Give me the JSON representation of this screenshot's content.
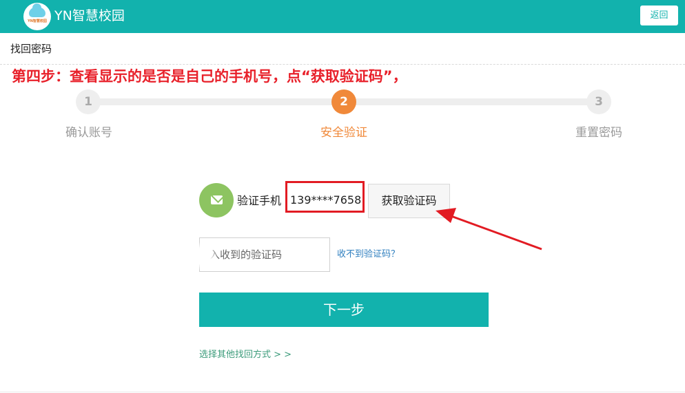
{
  "header": {
    "logo_text": "YN智慧校园",
    "app_title": "YN智慧校园",
    "back_label": "返回",
    "background_color": "#12b2ad"
  },
  "page": {
    "title": "找回密码",
    "annotation": "第四步：查看显示的是否是自己的手机号，点“获取验证码”，"
  },
  "steps": [
    {
      "number": "1",
      "label": "确认账号",
      "state": "done"
    },
    {
      "number": "2",
      "label": "安全验证",
      "state": "active"
    },
    {
      "number": "3",
      "label": "重置密码",
      "state": "pending"
    }
  ],
  "verify": {
    "label": "验证手机",
    "phone": "139****7658",
    "get_code_label": "获取验证码",
    "icon": "mail-icon"
  },
  "code_input": {
    "placeholder": "请输入收到的验证码",
    "visible_text": "入收到的验证码"
  },
  "links": {
    "not_received": "收不到验证码？",
    "other_methods": "选择其他找回方式 > >"
  },
  "actions": {
    "next_label": "下一步"
  },
  "colors": {
    "accent": "#12b2ad",
    "active_step": "#f0893a",
    "annotation_red": "#e8202a",
    "mail_green": "#8dc461"
  }
}
